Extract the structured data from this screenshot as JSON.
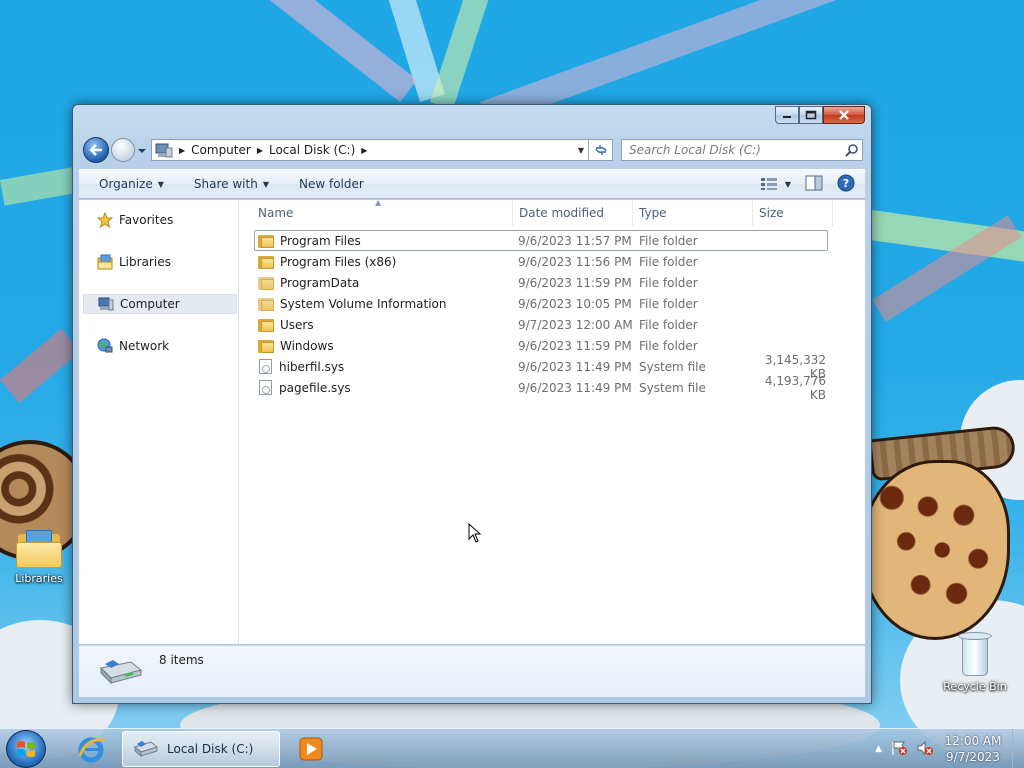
{
  "window": {
    "address": {
      "crumbs": [
        "Computer",
        "Local Disk (C:)"
      ]
    },
    "search_placeholder": "Search Local Disk (C:)",
    "commands": {
      "organize": "Organize",
      "share_with": "Share with",
      "new_folder": "New folder"
    },
    "nav_pane": {
      "favorites": "Favorites",
      "libraries": "Libraries",
      "computer": "Computer",
      "network": "Network"
    },
    "columns": {
      "name": "Name",
      "date_modified": "Date modified",
      "type": "Type",
      "size": "Size"
    },
    "files": [
      {
        "name": "Program Files",
        "date": "9/6/2023 11:57 PM",
        "type": "File folder",
        "size": "",
        "icon": "folder-icon"
      },
      {
        "name": "Program Files (x86)",
        "date": "9/6/2023 11:56 PM",
        "type": "File folder",
        "size": "",
        "icon": "folder-icon"
      },
      {
        "name": "ProgramData",
        "date": "9/6/2023 11:59 PM",
        "type": "File folder",
        "size": "",
        "icon": "folder-icon"
      },
      {
        "name": "System Volume Information",
        "date": "9/6/2023 10:05 PM",
        "type": "File folder",
        "size": "",
        "icon": "folder-icon"
      },
      {
        "name": "Users",
        "date": "9/7/2023 12:00 AM",
        "type": "File folder",
        "size": "",
        "icon": "folder-icon"
      },
      {
        "name": "Windows",
        "date": "9/6/2023 11:59 PM",
        "type": "File folder",
        "size": "",
        "icon": "folder-icon"
      },
      {
        "name": "hiberfil.sys",
        "date": "9/6/2023 11:49 PM",
        "type": "System file",
        "size": "3,145,332 KB",
        "icon": "system-file-icon"
      },
      {
        "name": "pagefile.sys",
        "date": "9/6/2023 11:49 PM",
        "type": "System file",
        "size": "4,193,776 KB",
        "icon": "system-file-icon"
      }
    ],
    "details": {
      "item_count": "8 items"
    }
  },
  "desktop": {
    "libraries_label": "Libraries",
    "recycle_bin_label": "Recycle Bin"
  },
  "taskbar": {
    "explorer_label": "Local Disk (C:)",
    "clock_time": "12:00 AM",
    "clock_date": "9/7/2023"
  },
  "colors": {
    "desktop_blue": "#1fa7e6",
    "window_frame": "#b9d1e8",
    "close_red": "#c33a1c",
    "link_text": "#1e395b"
  }
}
